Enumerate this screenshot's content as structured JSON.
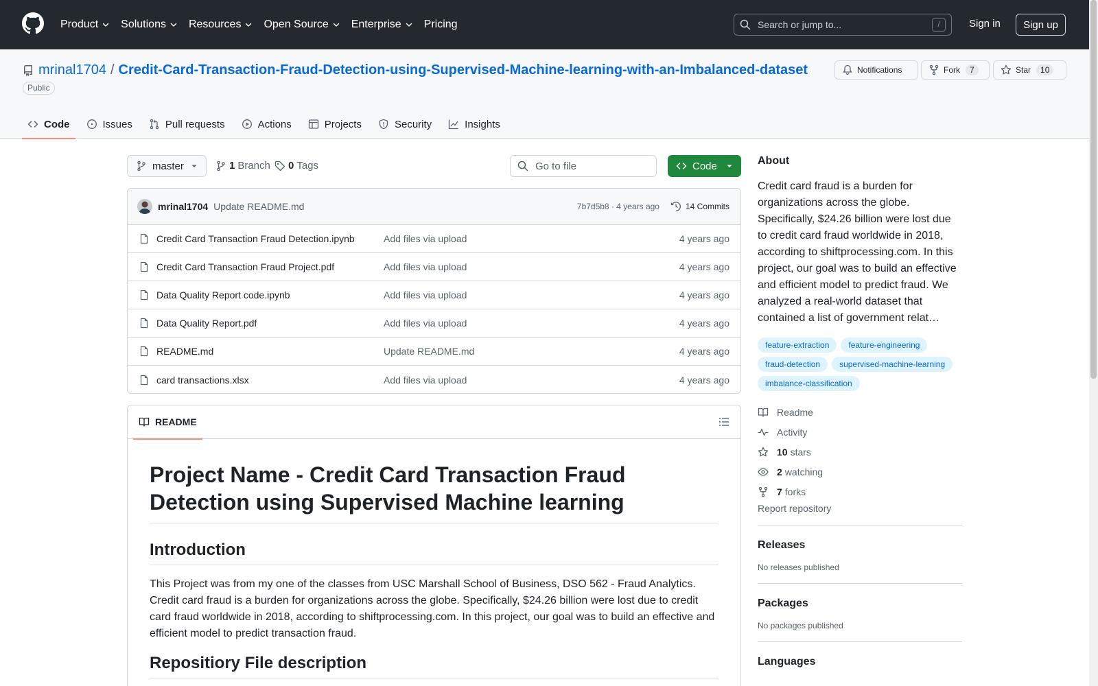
{
  "header": {
    "nav": [
      {
        "label": "Product",
        "dropdown": true
      },
      {
        "label": "Solutions",
        "dropdown": true
      },
      {
        "label": "Resources",
        "dropdown": true
      },
      {
        "label": "Open Source",
        "dropdown": true
      },
      {
        "label": "Enterprise",
        "dropdown": true
      },
      {
        "label": "Pricing",
        "dropdown": false
      }
    ],
    "search_placeholder": "Search or jump to...",
    "search_shortcut": "/",
    "sign_in": "Sign in",
    "sign_up": "Sign up",
    "background_color": "#24292f"
  },
  "repo": {
    "owner": "mrinal1704",
    "separator": "/",
    "name": "Credit-Card-Transaction-Fraud-Detection-using-Supervised-Machine-learning-with-an-Imbalanced-dataset",
    "visibility": "Public",
    "notifications_label": "Notifications",
    "fork_label": "Fork",
    "fork_count": "7",
    "star_label": "Star",
    "star_count": "10"
  },
  "tabs": [
    {
      "label": "Code",
      "icon": "code-icon",
      "active": true
    },
    {
      "label": "Issues",
      "icon": "issue-icon",
      "active": false
    },
    {
      "label": "Pull requests",
      "icon": "pull-request-icon",
      "active": false
    },
    {
      "label": "Actions",
      "icon": "play-icon",
      "active": false
    },
    {
      "label": "Projects",
      "icon": "table-icon",
      "active": false
    },
    {
      "label": "Security",
      "icon": "shield-icon",
      "active": false
    },
    {
      "label": "Insights",
      "icon": "graph-icon",
      "active": false
    }
  ],
  "toolbar": {
    "branch": "master",
    "branch_count": "1",
    "branch_label": "Branch",
    "tag_count": "0",
    "tag_label": "Tags",
    "go_to_file": "Go to file",
    "code_button": "Code",
    "code_button_color": "#1f883d"
  },
  "latest_commit": {
    "author": "mrinal1704",
    "message": "Update README.md",
    "sha_and_age": "7b7d5b8 · 4 years ago",
    "commits_label": "14 Commits"
  },
  "files": [
    {
      "name": "Credit Card Transaction Fraud Detection.ipynb",
      "message": "Add files via upload",
      "age": "4 years ago"
    },
    {
      "name": "Credit Card Transaction Fraud Project.pdf",
      "message": "Add files via upload",
      "age": "4 years ago"
    },
    {
      "name": "Data Quality Report code.ipynb",
      "message": "Add files via upload",
      "age": "4 years ago"
    },
    {
      "name": "Data Quality Report.pdf",
      "message": "Add files via upload",
      "age": "4 years ago"
    },
    {
      "name": "README.md",
      "message": "Update README.md",
      "age": "4 years ago"
    },
    {
      "name": "card transactions.xlsx",
      "message": "Add files via upload",
      "age": "4 years ago"
    }
  ],
  "readme": {
    "tab_label": "README",
    "h1": "Project Name - Credit Card Transaction Fraud Detection using Supervised Machine learning",
    "intro_heading": "Introduction",
    "intro_text": "This Project was from my one of the classes from USC Marshall School of Business, DSO 562 - Fraud Analytics. Credit card fraud is a burden for organizations across the globe. Specifically, $24.26 billion were lost due to credit card fraud worldwide in 2018, according to shiftprocessing.com. In this project, our goal was to build an effective and efficient model to predict transaction fraud.",
    "files_heading": "Repositiory File description"
  },
  "about": {
    "heading": "About",
    "description": "Credit card fraud is a burden for organizations across the globe. Specifically, $24.26 billion were lost due to credit card fraud worldwide in 2018, according to shiftprocessing.com. In this project, our goal was to build an effective and efficient model to predict fraud. We analyzed a real-world dataset that contained a list of government relat…",
    "topics": [
      "feature-extraction",
      "feature-engineering",
      "fraud-detection",
      "supervised-machine-learning",
      "imbalance-classification"
    ],
    "links": [
      {
        "icon": "book-icon",
        "strong": "",
        "label": "Readme"
      },
      {
        "icon": "pulse-icon",
        "strong": "",
        "label": "Activity"
      },
      {
        "icon": "star-icon",
        "strong": "10",
        "label": "stars"
      },
      {
        "icon": "eye-icon",
        "strong": "2",
        "label": "watching"
      },
      {
        "icon": "fork-icon",
        "strong": "7",
        "label": "forks"
      }
    ],
    "report": "Report repository"
  },
  "releases": {
    "heading": "Releases",
    "text": "No releases published"
  },
  "packages": {
    "heading": "Packages",
    "text": "No packages published"
  },
  "languages": {
    "heading": "Languages"
  }
}
